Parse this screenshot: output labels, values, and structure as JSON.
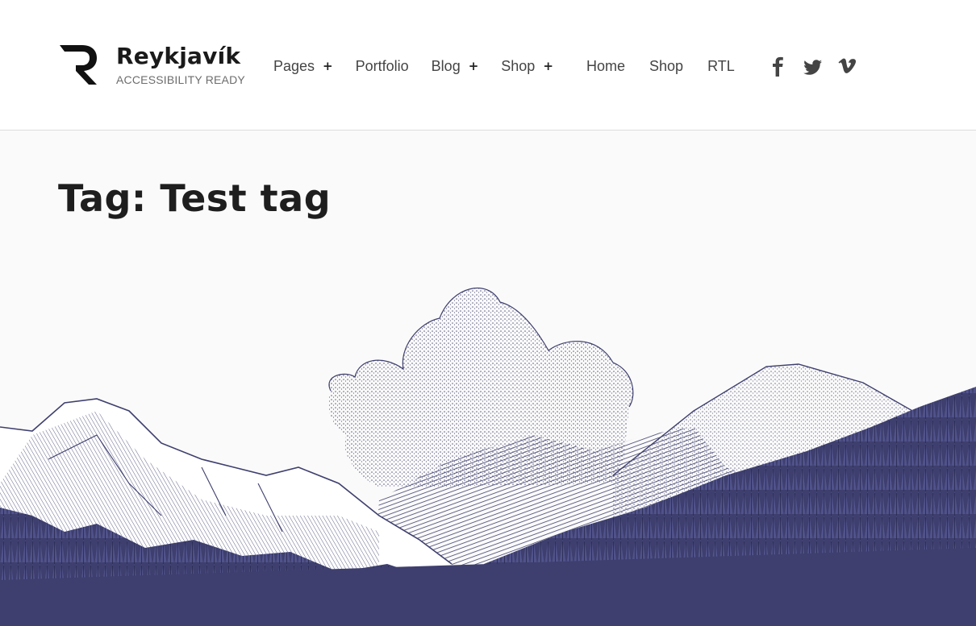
{
  "site": {
    "title": "Reykjavík",
    "tagline": "ACCESSIBILITY READY"
  },
  "primary_nav": [
    {
      "label": "Pages",
      "has_submenu": true
    },
    {
      "label": "Portfolio",
      "has_submenu": false
    },
    {
      "label": "Blog",
      "has_submenu": true
    },
    {
      "label": "Shop",
      "has_submenu": true
    }
  ],
  "submenu_toggle_symbol": "+",
  "secondary_nav": [
    {
      "label": "Home"
    },
    {
      "label": "Shop"
    },
    {
      "label": "RTL"
    }
  ],
  "social_links": [
    {
      "icon": "facebook-icon"
    },
    {
      "icon": "twitter-icon"
    },
    {
      "icon": "vimeo-icon"
    }
  ],
  "archive": {
    "title": "Tag: Test tag"
  },
  "colors": {
    "ink": "#3e3f6e",
    "text": "#1a1a1a",
    "background": "#fafafa"
  }
}
